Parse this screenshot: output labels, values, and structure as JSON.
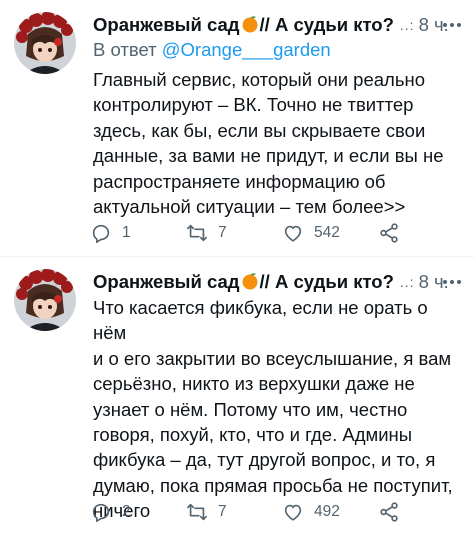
{
  "tweets": [
    {
      "author_name": "Оранжевый сад",
      "author_title": "// А судьи кто?",
      "dots": "..:",
      "time": "8 ч.",
      "reply_prefix": "В ответ ",
      "reply_handle": "@Orange___garden",
      "lines": [
        "Главный сервис, который они реально",
        "контролируют – ВК. Точно не твиттер",
        "здесь, как бы, если вы скрываете свои",
        "данные, за вами не придут, и если вы не",
        "распространяете информацию об",
        "актуальной ситуации – тем более>>"
      ],
      "replies": "1",
      "retweets": "7",
      "likes": "542"
    },
    {
      "author_name": "Оранжевый сад",
      "author_title": "// А судьи кто?",
      "dots": "..:",
      "time": "8 ч.",
      "lines": [
        "Что касается фикбука, если не орать о нём",
        "и о его закрытии во всеуслышание, я вам",
        "серьёзно, никто из верхушки даже не",
        "узнает о нём. Потому что им, честно",
        "говоря, похуй, кто, что и где. Админы",
        "фикбука – да, тут другой вопрос, и то, я",
        "думаю, пока прямая просьба не поступит,",
        "ничего"
      ],
      "replies": "2",
      "retweets": "7",
      "likes": "492"
    }
  ],
  "icons": {
    "reply": "reply-icon",
    "retweet": "retweet-icon",
    "like": "heart-icon",
    "share": "share-icon",
    "emoji": "orange-emoji",
    "more": "more-icon"
  },
  "colors": {
    "text": "#0f1419",
    "secondary": "#536471",
    "link": "#1d9bf0",
    "orange_emoji": "#f4900c"
  }
}
